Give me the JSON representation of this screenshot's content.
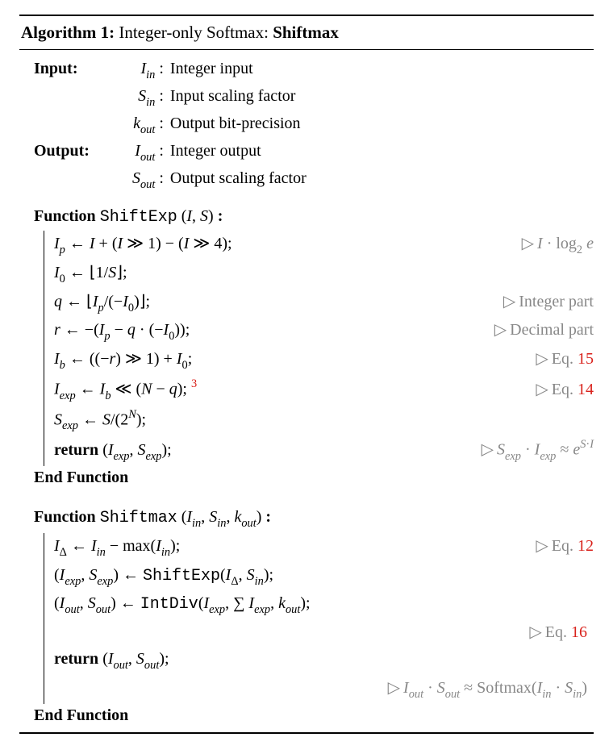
{
  "alg": {
    "number": "Algorithm 1:",
    "name": "Integer-only Softmax:",
    "bold": "Shiftmax"
  },
  "io": {
    "input_label": "Input:",
    "output_label": "Output:",
    "rows": [
      {
        "var": "I_in",
        "colon": " :",
        "desc": "Integer input"
      },
      {
        "var": "S_in",
        "colon": " :",
        "desc": "Input scaling factor"
      },
      {
        "var": "k_out",
        "colon": " :",
        "desc": "Output bit-precision"
      },
      {
        "var": "I_out",
        "colon": " :",
        "desc": "Integer output"
      },
      {
        "var": "S_out",
        "colon": " :",
        "desc": "Output scaling factor"
      }
    ]
  },
  "f1": {
    "kw": "Function",
    "name": "ShiftExp",
    "args": "(I, S)",
    "colon": ":",
    "lines": [
      {
        "stmt": "I_p ← I + (I ≫ 1) − (I ≫ 4);",
        "cmt": "▷ I · log₂ e"
      },
      {
        "stmt": "I₀ ← ⌊1/S⌋;",
        "cmt": ""
      },
      {
        "stmt": "q ← ⌊I_p/(−I₀)⌋;",
        "cmt": "▷ Integer part"
      },
      {
        "stmt": "r ← −(I_p − q · (−I₀));",
        "cmt": "▷ Decimal part"
      },
      {
        "stmt": "I_b ← ((−r) ≫ 1) + I₀;",
        "cmt": "▷ Eq.",
        "ref": "15"
      },
      {
        "stmt": "I_exp ← I_b ≪ (N − q);",
        "fn": "3",
        "cmt": "▷ Eq.",
        "ref": "14"
      },
      {
        "stmt": "S_exp ← S/(2^N);",
        "cmt": ""
      },
      {
        "stmt": "return (I_exp, S_exp);",
        "kw": true,
        "cmt": "▷ S_exp · I_exp ≈ e^{S·I}"
      }
    ],
    "end": "End Function"
  },
  "f2": {
    "kw": "Function",
    "name": "Shiftmax",
    "args": "(I_in, S_in, k_out)",
    "colon": ":",
    "lines": [
      {
        "stmt": "I_Δ ← I_in − max(I_in);",
        "cmt": "▷ Eq.",
        "ref": "12"
      },
      {
        "stmt": "(I_exp, S_exp) ← ShiftExp(I_Δ, S_in);",
        "cmt": ""
      },
      {
        "stmt": "(I_out, S_out) ← IntDiv(I_exp, ∑ I_exp, k_out);",
        "cmt": ""
      },
      {
        "trail_cmt": "▷ Eq.",
        "ref": "16"
      },
      {
        "stmt": "return (I_out, S_out);",
        "kw": true,
        "cmt": ""
      },
      {
        "trail_cmt": "▷ I_out · S_out ≈ Softmax(I_in · S_in)"
      }
    ],
    "end": "End Function"
  }
}
